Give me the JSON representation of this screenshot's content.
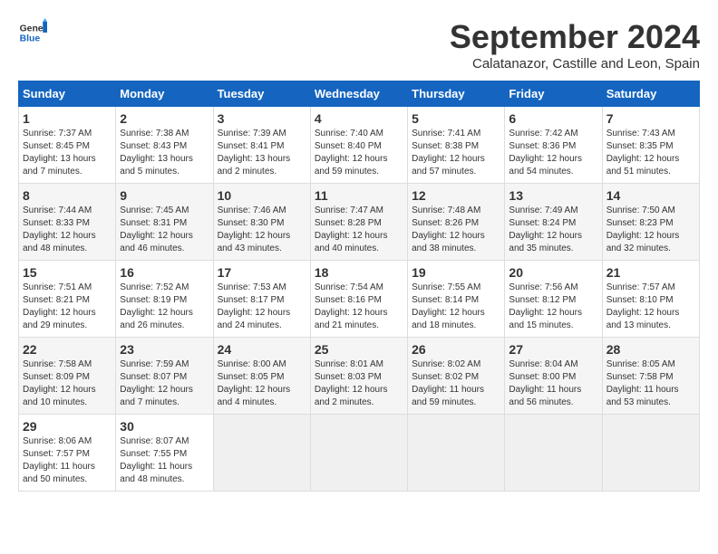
{
  "header": {
    "logo_general": "General",
    "logo_blue": "Blue",
    "month_title": "September 2024",
    "subtitle": "Calatanazor, Castille and Leon, Spain"
  },
  "calendar": {
    "days_of_week": [
      "Sunday",
      "Monday",
      "Tuesday",
      "Wednesday",
      "Thursday",
      "Friday",
      "Saturday"
    ],
    "weeks": [
      [
        {
          "day": "1",
          "sunrise": "7:37 AM",
          "sunset": "8:45 PM",
          "daylight": "13 hours and 7 minutes."
        },
        {
          "day": "2",
          "sunrise": "7:38 AM",
          "sunset": "8:43 PM",
          "daylight": "13 hours and 5 minutes."
        },
        {
          "day": "3",
          "sunrise": "7:39 AM",
          "sunset": "8:41 PM",
          "daylight": "13 hours and 2 minutes."
        },
        {
          "day": "4",
          "sunrise": "7:40 AM",
          "sunset": "8:40 PM",
          "daylight": "12 hours and 59 minutes."
        },
        {
          "day": "5",
          "sunrise": "7:41 AM",
          "sunset": "8:38 PM",
          "daylight": "12 hours and 57 minutes."
        },
        {
          "day": "6",
          "sunrise": "7:42 AM",
          "sunset": "8:36 PM",
          "daylight": "12 hours and 54 minutes."
        },
        {
          "day": "7",
          "sunrise": "7:43 AM",
          "sunset": "8:35 PM",
          "daylight": "12 hours and 51 minutes."
        }
      ],
      [
        {
          "day": "8",
          "sunrise": "7:44 AM",
          "sunset": "8:33 PM",
          "daylight": "12 hours and 48 minutes."
        },
        {
          "day": "9",
          "sunrise": "7:45 AM",
          "sunset": "8:31 PM",
          "daylight": "12 hours and 46 minutes."
        },
        {
          "day": "10",
          "sunrise": "7:46 AM",
          "sunset": "8:30 PM",
          "daylight": "12 hours and 43 minutes."
        },
        {
          "day": "11",
          "sunrise": "7:47 AM",
          "sunset": "8:28 PM",
          "daylight": "12 hours and 40 minutes."
        },
        {
          "day": "12",
          "sunrise": "7:48 AM",
          "sunset": "8:26 PM",
          "daylight": "12 hours and 38 minutes."
        },
        {
          "day": "13",
          "sunrise": "7:49 AM",
          "sunset": "8:24 PM",
          "daylight": "12 hours and 35 minutes."
        },
        {
          "day": "14",
          "sunrise": "7:50 AM",
          "sunset": "8:23 PM",
          "daylight": "12 hours and 32 minutes."
        }
      ],
      [
        {
          "day": "15",
          "sunrise": "7:51 AM",
          "sunset": "8:21 PM",
          "daylight": "12 hours and 29 minutes."
        },
        {
          "day": "16",
          "sunrise": "7:52 AM",
          "sunset": "8:19 PM",
          "daylight": "12 hours and 26 minutes."
        },
        {
          "day": "17",
          "sunrise": "7:53 AM",
          "sunset": "8:17 PM",
          "daylight": "12 hours and 24 minutes."
        },
        {
          "day": "18",
          "sunrise": "7:54 AM",
          "sunset": "8:16 PM",
          "daylight": "12 hours and 21 minutes."
        },
        {
          "day": "19",
          "sunrise": "7:55 AM",
          "sunset": "8:14 PM",
          "daylight": "12 hours and 18 minutes."
        },
        {
          "day": "20",
          "sunrise": "7:56 AM",
          "sunset": "8:12 PM",
          "daylight": "12 hours and 15 minutes."
        },
        {
          "day": "21",
          "sunrise": "7:57 AM",
          "sunset": "8:10 PM",
          "daylight": "12 hours and 13 minutes."
        }
      ],
      [
        {
          "day": "22",
          "sunrise": "7:58 AM",
          "sunset": "8:09 PM",
          "daylight": "12 hours and 10 minutes."
        },
        {
          "day": "23",
          "sunrise": "7:59 AM",
          "sunset": "8:07 PM",
          "daylight": "12 hours and 7 minutes."
        },
        {
          "day": "24",
          "sunrise": "8:00 AM",
          "sunset": "8:05 PM",
          "daylight": "12 hours and 4 minutes."
        },
        {
          "day": "25",
          "sunrise": "8:01 AM",
          "sunset": "8:03 PM",
          "daylight": "12 hours and 2 minutes."
        },
        {
          "day": "26",
          "sunrise": "8:02 AM",
          "sunset": "8:02 PM",
          "daylight": "11 hours and 59 minutes."
        },
        {
          "day": "27",
          "sunrise": "8:04 AM",
          "sunset": "8:00 PM",
          "daylight": "11 hours and 56 minutes."
        },
        {
          "day": "28",
          "sunrise": "8:05 AM",
          "sunset": "7:58 PM",
          "daylight": "11 hours and 53 minutes."
        }
      ],
      [
        {
          "day": "29",
          "sunrise": "8:06 AM",
          "sunset": "7:57 PM",
          "daylight": "11 hours and 50 minutes."
        },
        {
          "day": "30",
          "sunrise": "8:07 AM",
          "sunset": "7:55 PM",
          "daylight": "11 hours and 48 minutes."
        },
        null,
        null,
        null,
        null,
        null
      ]
    ],
    "sunrise_label": "Sunrise:",
    "sunset_label": "Sunset:",
    "daylight_label": "Daylight:"
  }
}
